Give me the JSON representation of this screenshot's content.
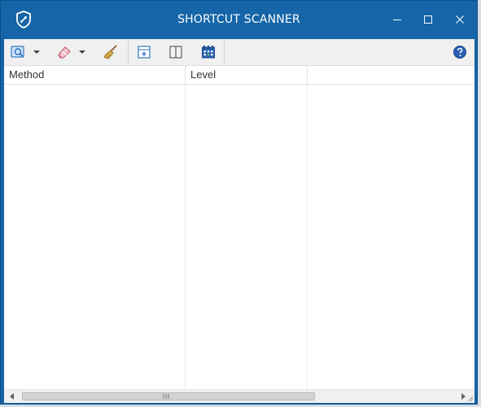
{
  "window": {
    "title": "SHORTCUT SCANNER",
    "colors": {
      "titlebar": "#1565a8",
      "accent": "#2a6cc7",
      "help": "#2a5fb0"
    }
  },
  "titlebar_icons": [
    "shield-logo-icon",
    "minimize-icon",
    "maximize-icon",
    "close-icon"
  ],
  "toolbar": {
    "buttons": [
      "scan-icon",
      "scan-dropdown-icon",
      "eraser-icon",
      "eraser-dropdown-icon",
      "broom-icon",
      "expand-icon",
      "columns-icon",
      "calendar-icon",
      "help-icon"
    ]
  },
  "grid": {
    "columns": [
      "Method",
      "Level",
      ""
    ],
    "rows": []
  },
  "scrollbar": {
    "left_arrow": "arrow-left-icon",
    "right_arrow": "arrow-right-icon",
    "thumb_grip": "grip-icon"
  }
}
